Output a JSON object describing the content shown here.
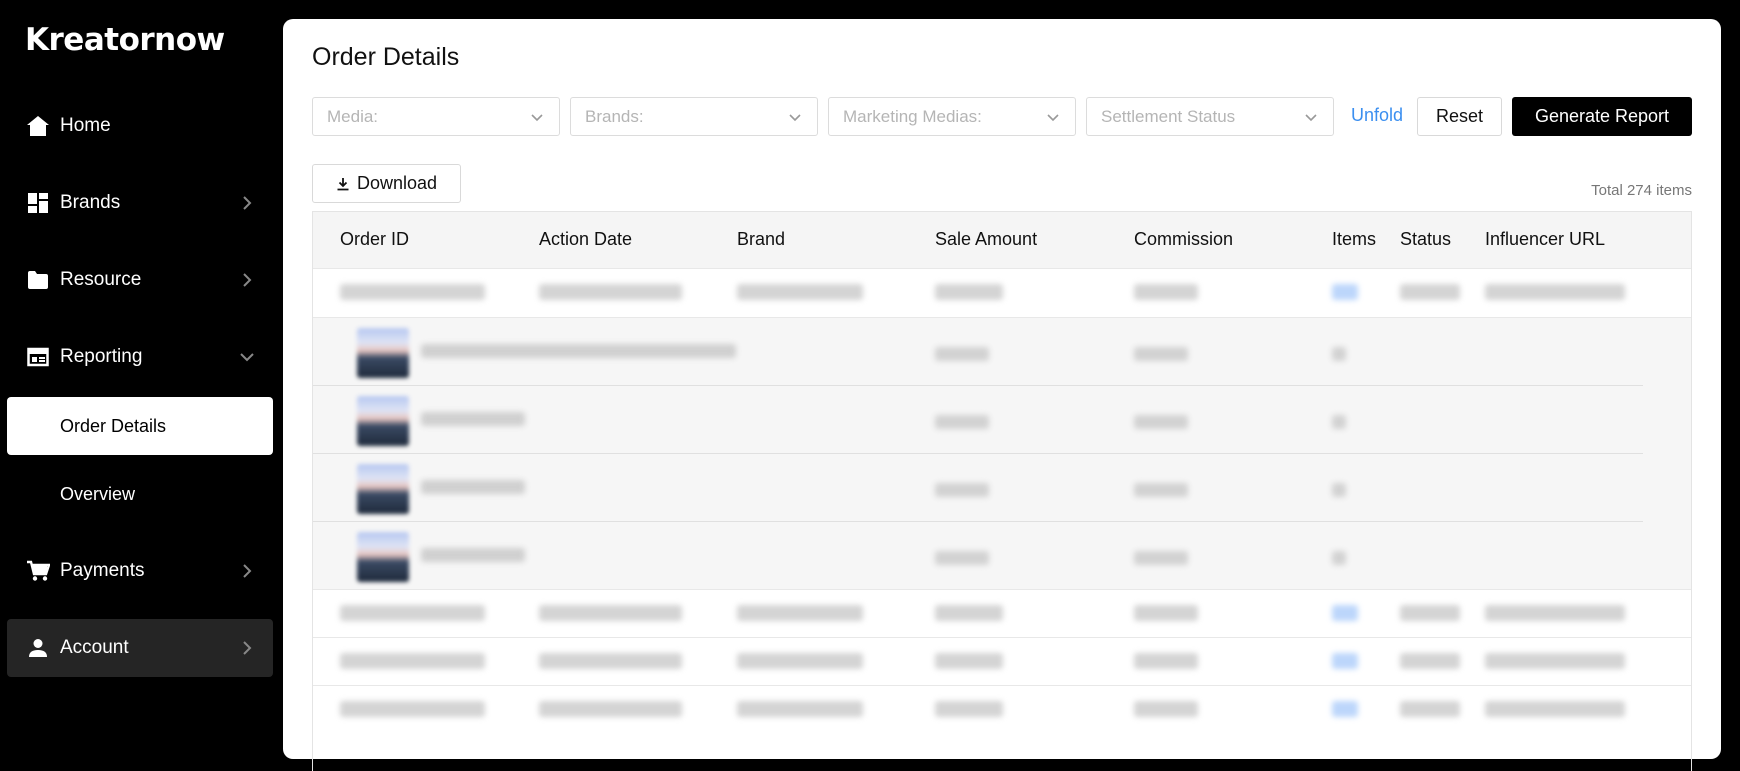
{
  "app": {
    "logo": "Kreatornow"
  },
  "sidebar": {
    "items": [
      {
        "label": "Home",
        "icon": "home-icon"
      },
      {
        "label": "Brands",
        "icon": "dashboard-icon"
      },
      {
        "label": "Resource",
        "icon": "folder-icon"
      },
      {
        "label": "Reporting",
        "icon": "report-icon"
      },
      {
        "label": "Order Details"
      },
      {
        "label": "Overview"
      },
      {
        "label": "Payments",
        "icon": "cart-icon"
      },
      {
        "label": "Account",
        "icon": "person-icon"
      }
    ]
  },
  "page": {
    "title": "Order Details"
  },
  "filters": {
    "media": "Media:",
    "brands": "Brands:",
    "marketing_medias": "Marketing Medias:",
    "settlement_status": "Settlement Status",
    "unfold": "Unfold",
    "reset": "Reset",
    "generate_report": "Generate Report"
  },
  "toolbar": {
    "download": "Download",
    "total": "Total 274 items"
  },
  "table": {
    "columns": [
      "Order ID",
      "Action Date",
      "Brand",
      "Sale Amount",
      "Commission",
      "Items",
      "Status",
      "Influencer URL"
    ]
  },
  "colors": {
    "accent_link": "#3b8ff0",
    "primary_button": "#000000",
    "active_nav_bg": "#ffffff"
  }
}
